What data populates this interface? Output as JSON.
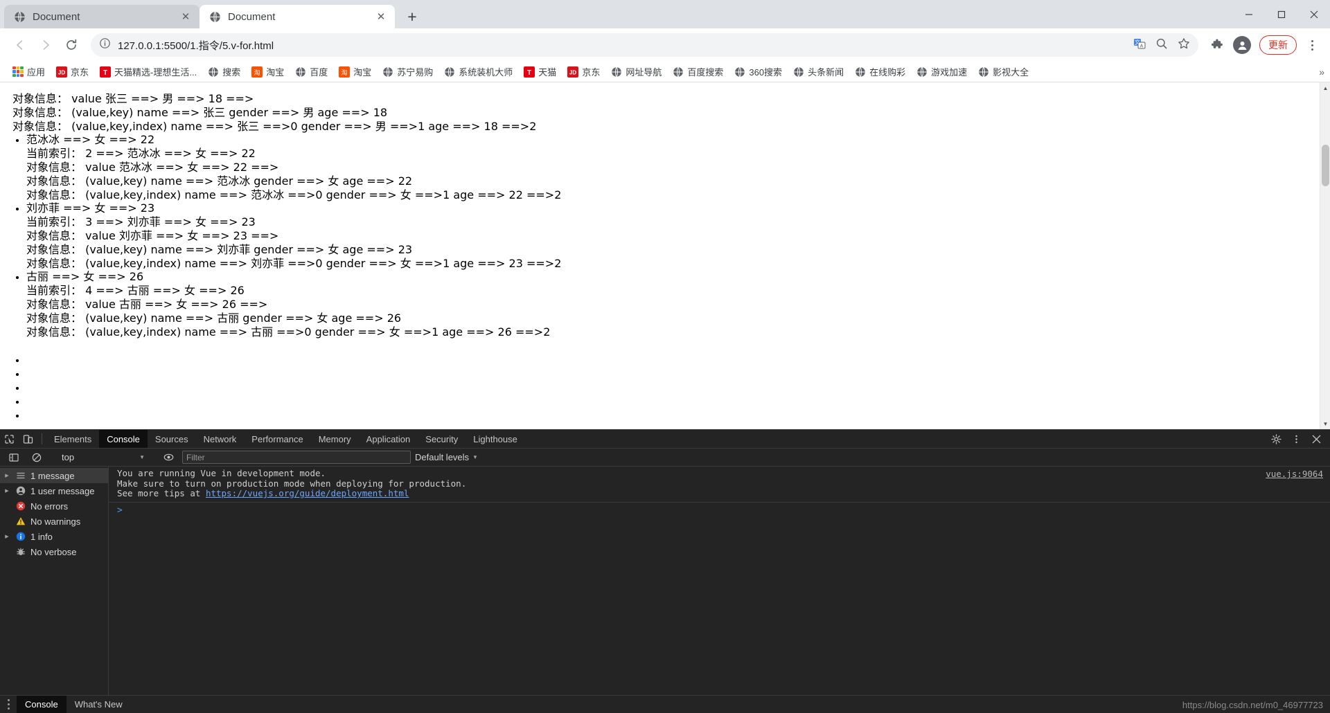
{
  "browser": {
    "tabs": [
      {
        "title": "Document",
        "favicon": "globe-icon",
        "active": false
      },
      {
        "title": "Document",
        "favicon": "globe-icon",
        "active": true
      }
    ],
    "new_tab_label": "+",
    "window_controls": {
      "minimize": "—",
      "maximize": "☐",
      "close": "✕"
    },
    "toolbar": {
      "back": "←",
      "forward": "→",
      "reload": "⟳",
      "site_info_icon": "info-circle-icon",
      "url": "127.0.0.1:5500/1.指令/5.v-for.html",
      "translate_icon": "translate-icon",
      "zoom_icon": "magnifier-icon",
      "bookmark_icon": "star-icon",
      "extensions_icon": "puzzle-icon",
      "profile_icon": "account-icon",
      "update_label": "更新",
      "menu_icon": "kebab-menu-icon"
    },
    "bookmarks": [
      {
        "label": "应用",
        "icon": "apps-grid-icon"
      },
      {
        "label": "京东",
        "icon": "jd-icon"
      },
      {
        "label": "天猫精选-理想生活...",
        "icon": "tmall-icon"
      },
      {
        "label": "搜索",
        "icon": "globe-icon"
      },
      {
        "label": "淘宝",
        "icon": "taobao-icon"
      },
      {
        "label": "百度",
        "icon": "globe-icon"
      },
      {
        "label": "淘宝",
        "icon": "taobao-icon"
      },
      {
        "label": "苏宁易购",
        "icon": "globe-icon"
      },
      {
        "label": "系统装机大师",
        "icon": "globe-icon"
      },
      {
        "label": "天猫",
        "icon": "tmall-icon"
      },
      {
        "label": "京东",
        "icon": "jd-icon"
      },
      {
        "label": "网址导航",
        "icon": "globe-icon"
      },
      {
        "label": "百度搜索",
        "icon": "globe-icon"
      },
      {
        "label": "360搜索",
        "icon": "globe-icon"
      },
      {
        "label": "头条新闻",
        "icon": "globe-icon"
      },
      {
        "label": "在线购彩",
        "icon": "globe-icon"
      },
      {
        "label": "游戏加速",
        "icon": "globe-icon"
      },
      {
        "label": "影视大全",
        "icon": "globe-icon"
      }
    ],
    "bookmarks_overflow": "»"
  },
  "page": {
    "entries": [
      {
        "bullet": "范冰冰 ==> 女 ==> 22",
        "index_line": "当前索引： 2 ==> 范冰冰 ==> 女 ==> 22",
        "obj_value": "对象信息： value 范冰冰 ==> 女 ==> 22 ==>",
        "obj_key": "对象信息： (value,key) name ==> 范冰冰 gender ==> 女 age ==> 22",
        "obj_index": "对象信息： (value,key,index) name ==> 范冰冰 ==>0 gender ==> 女 ==>1 age ==> 22 ==>2"
      },
      {
        "bullet": "刘亦菲 ==> 女 ==> 23",
        "index_line": "当前索引： 3 ==> 刘亦菲 ==> 女 ==> 23",
        "obj_value": "对象信息： value 刘亦菲 ==> 女 ==> 23 ==>",
        "obj_key": "对象信息： (value,key) name ==> 刘亦菲 gender ==> 女 age ==> 23",
        "obj_index": "对象信息： (value,key,index) name ==> 刘亦菲 ==>0 gender ==> 女 ==>1 age ==> 23 ==>2"
      },
      {
        "bullet": "古丽 ==> 女 ==> 26",
        "index_line": "当前索引： 4 ==> 古丽 ==> 女 ==> 26",
        "obj_value": "对象信息： value 古丽 ==> 女 ==> 26 ==>",
        "obj_key": "对象信息： (value,key) name ==> 古丽 gender ==> 女 age ==> 26",
        "obj_index": "对象信息： (value,key,index) name ==> 古丽 ==>0 gender ==> 女 ==>1 age ==> 26 ==>2"
      }
    ],
    "top_partial": {
      "obj_value": "对象信息： value 张三 ==> 男 ==> 18 ==>",
      "obj_key": "对象信息： (value,key) name ==> 张三 gender ==> 男 age ==> 18",
      "obj_index": "对象信息： (value,key,index) name ==> 张三 ==>0 gender ==> 男 ==>1 age ==> 18 ==>2"
    },
    "prompt": ">"
  },
  "devtools": {
    "tabs": [
      "Elements",
      "Console",
      "Sources",
      "Network",
      "Performance",
      "Memory",
      "Application",
      "Security",
      "Lighthouse"
    ],
    "active_tab": "Console",
    "inspect_icon": "inspect-cursor-icon",
    "device_icon": "device-toolbar-icon",
    "settings_icon": "gear-icon",
    "more_icon": "kebab-menu-icon",
    "close_icon": "close-icon",
    "filterbar": {
      "sidebar_toggle_icon": "console-sidebar-icon",
      "clear_icon": "clear-console-icon",
      "context": "top",
      "eye_icon": "live-expression-icon",
      "filter_placeholder": "Filter",
      "levels_label": "Default levels"
    },
    "sidebar": [
      {
        "label": "1 message",
        "icon": "list-icon",
        "selected": true,
        "caret": true,
        "color": "#b0b0b0"
      },
      {
        "label": "1 user message",
        "icon": "user-icon",
        "selected": false,
        "caret": true,
        "color": "#b0b0b0"
      },
      {
        "label": "No errors",
        "icon": "error-icon",
        "selected": false,
        "caret": false,
        "color": "#e53935"
      },
      {
        "label": "No warnings",
        "icon": "warning-icon",
        "selected": false,
        "caret": false,
        "color": "#f5c211"
      },
      {
        "label": "1 info",
        "icon": "info-icon",
        "selected": false,
        "caret": true,
        "color": "#1a73e8"
      },
      {
        "label": "No verbose",
        "icon": "bug-icon",
        "selected": false,
        "caret": false,
        "color": "#b0b0b0"
      }
    ],
    "message": {
      "line1": "You are running Vue in development mode.",
      "line2": "Make sure to turn on production mode when deploying for production.",
      "line3_prefix": "See more tips at ",
      "line3_link": "https://vuejs.org/guide/deployment.html",
      "source": "vue.js:9064"
    },
    "console_prompt": ">",
    "drawer_tabs": [
      "Console",
      "What's New"
    ],
    "drawer_active": "Console",
    "watermark": "https://blog.csdn.net/m0_46977723"
  },
  "colors": {
    "chrome_tabstrip": "#dee1e6",
    "accent_red": "#d93025",
    "devtools_bg": "#242424",
    "devtools_active_tab": "#0f0f0f"
  }
}
